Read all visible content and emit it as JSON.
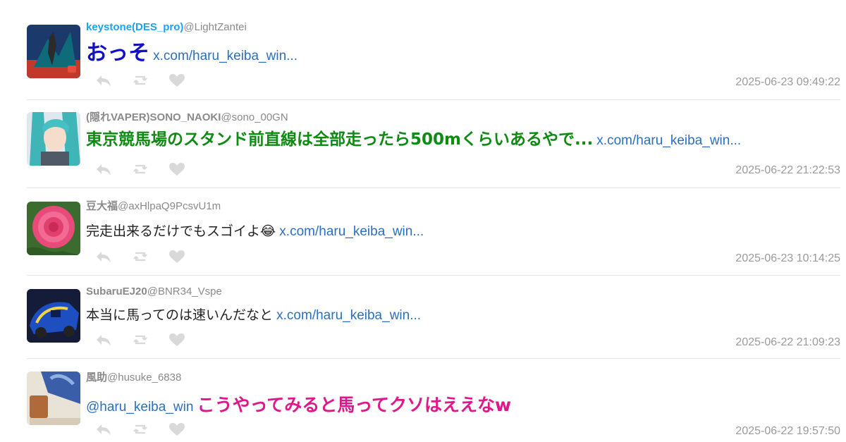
{
  "tweets": [
    {
      "user": "keystone(DES_pro)",
      "handle": "@LightZantei",
      "text": "おっそ",
      "link": "x.com/haru_keiba_win...",
      "time": "2025-06-23 09:49:22",
      "text_color": "#1010c8"
    },
    {
      "user": "(隠れVAPER)SONO_NAOKI",
      "handle": "@sono_00GN",
      "text": "東京競馬場のスタンド前直線は全部走ったら500mくらいあるやで...",
      "link": "x.com/haru_keiba_win...",
      "time": "2025-06-22 21:22:53",
      "text_color": "#0f8a12"
    },
    {
      "user": "豆大福",
      "handle": "@axHlpaQ9PcsvU1m",
      "text": "完走出来るだけでもスゴイよ😂",
      "link": "x.com/haru_keiba_win...",
      "time": "2025-06-23 10:14:25",
      "text_color": "#222222"
    },
    {
      "user": "SubaruEJ20",
      "handle": "@BNR34_Vspe",
      "text": "本当に馬ってのは速いんだなと",
      "link": "x.com/haru_keiba_win...",
      "time": "2025-06-22 21:09:23",
      "text_color": "#222222"
    },
    {
      "user": "風助",
      "handle": "@husuke_6838",
      "mention": "@haru_keiba_win",
      "text": "こうやってみると馬ってクソはええなw",
      "time": "2025-06-22 19:57:50",
      "text_color": "#e0168c"
    }
  ],
  "icons": {
    "reply": "reply-icon",
    "retweet": "retweet-icon",
    "like": "heart-icon"
  },
  "colors": {
    "username_highlight": "#1da1f2",
    "username": "#8a8a8a",
    "link": "#2b6fbf",
    "timestamp": "#9a9a9a",
    "action_icon": "#d9d9d9"
  }
}
